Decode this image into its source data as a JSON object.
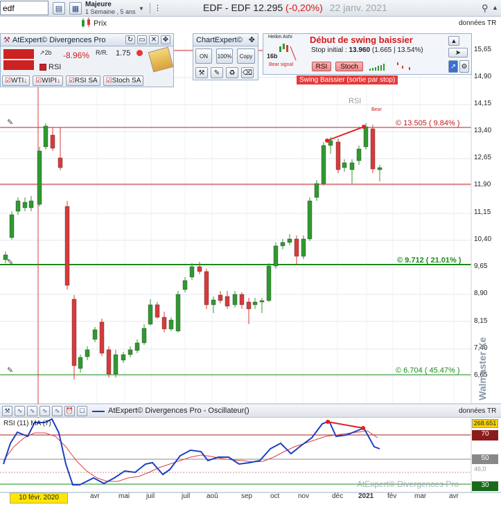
{
  "toolbar": {
    "symbol_value": "edf",
    "period_name": "Majeure",
    "period_range": "1 Semaine , 5 ans",
    "price_label": "Prix"
  },
  "header": {
    "title": "EDF - EDF  12.295",
    "change": "(-0,20%)",
    "date": "22 janv. 2021",
    "data_source": "données TR"
  },
  "atexpert_panel": {
    "title": "AtExpert© Divergences Pro",
    "pct": "-8.96%",
    "rr_value": "1.75",
    "rsi_label": "RSI",
    "tabs": [
      "WTI",
      "WIPI",
      "RSI SA",
      "Stoch SA"
    ]
  },
  "chartexpert_panel": {
    "title": "ChartExpert©",
    "buttons": [
      "ON",
      "100%",
      "Copy"
    ]
  },
  "signal_panel": {
    "heikin": "Heikin Ashi",
    "bars": "16b",
    "bear_signal": "Bear signal",
    "title": "Début de swing baissier",
    "stop_label": "Stop initial :",
    "stop_value": "13.960",
    "stop_detail": "(1.665 | 13.54%)",
    "btn_rsi": "RSI",
    "btn_stoch": "Stoch"
  },
  "swing_banner": "Swing Baissier (sortie par stop)",
  "price_axis": [
    "15,65",
    "14,90",
    "14,15",
    "13,40",
    "12,65",
    "11,90",
    "11,15",
    "10,40",
    "9,65",
    "8,90",
    "8,15",
    "7,40",
    "6,65"
  ],
  "levels": {
    "top": "© 13.505 ( 9.84% )",
    "mid": "© 9.712 ( 21.01% )",
    "low": "© 6.704 ( 45.47% )"
  },
  "annotations": {
    "rsi_label": "RSI",
    "bear": "Bear"
  },
  "watermark": "Walmaster Xe",
  "osc_panel": {
    "title": "AtExpert© Divergences Pro - Oscillateur()",
    "data_source": "données TR",
    "label": "RSI (11) MA (7)",
    "watermark": "AtExpert© Divergences Pro",
    "axis_labels": [
      "268.651",
      "70",
      "50",
      "30",
      "46,0"
    ]
  },
  "time_axis": {
    "cursor_date": "10 févr. 2020",
    "months": [
      "avr",
      "mai",
      "juil",
      "juil",
      "aoû",
      "sep",
      "oct",
      "nov",
      "déc",
      "2021",
      "fév",
      "mar",
      "avr"
    ]
  },
  "colors": {
    "up": "#2f9a2f",
    "down": "#d93a3a",
    "rsi": "#1c3fc4",
    "ma": "#d94040",
    "level_green": "#1a8a1a",
    "level_red": "#c01a1a"
  }
}
